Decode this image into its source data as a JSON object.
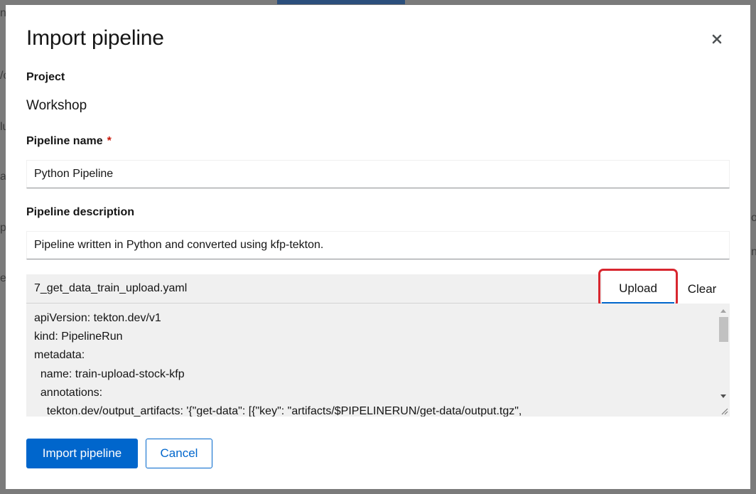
{
  "background": {
    "fragments": [
      "n",
      "/c",
      "lu",
      "a",
      "p",
      "e",
      "o",
      "n"
    ]
  },
  "modal": {
    "title": "Import pipeline",
    "close_icon": "close-icon"
  },
  "project": {
    "label": "Project",
    "value": "Workshop"
  },
  "pipeline_name": {
    "label": "Pipeline name",
    "required_marker": "*",
    "value": "Python Pipeline"
  },
  "pipeline_description": {
    "label": "Pipeline description",
    "value": "Pipeline written in Python and converted using kfp-tekton."
  },
  "file_upload": {
    "filename": "7_get_data_train_upload.yaml",
    "upload_label": "Upload",
    "clear_label": "Clear",
    "content": "apiVersion: tekton.dev/v1\nkind: PipelineRun\nmetadata:\n  name: train-upload-stock-kfp\n  annotations:\n    tekton.dev/output_artifacts: '{\"get-data\": [{\"key\": \"artifacts/$PIPELINERUN/get-data/output.tgz\","
  },
  "footer": {
    "import_label": "Import pipeline",
    "cancel_label": "Cancel"
  },
  "colors": {
    "primary": "#0066cc",
    "highlight": "#d8262f",
    "required": "#c9190b"
  }
}
